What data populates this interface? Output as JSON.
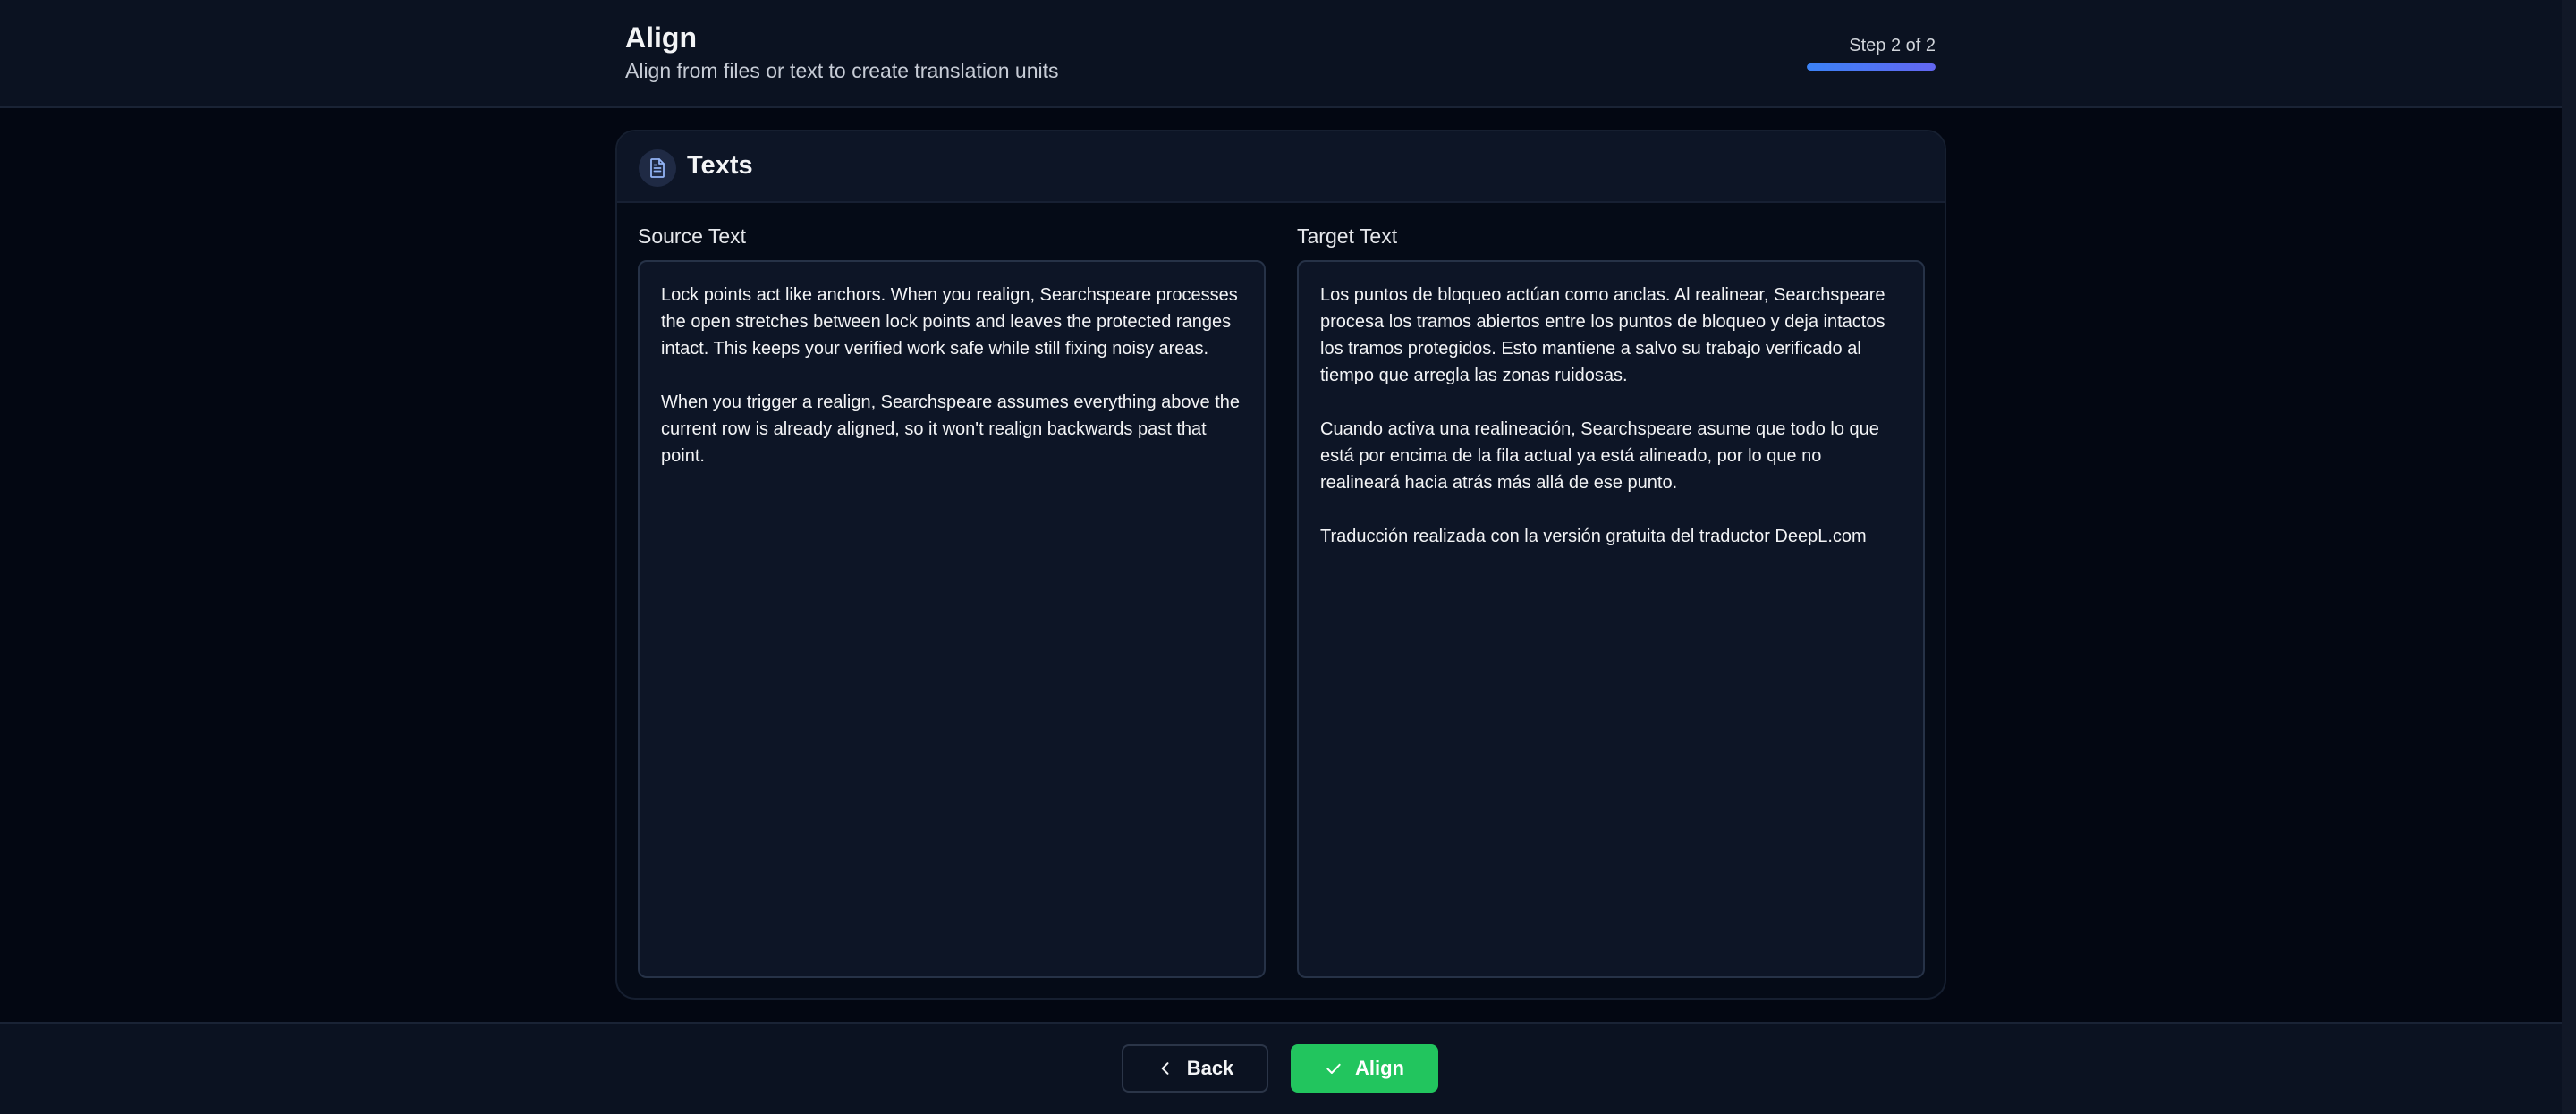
{
  "header": {
    "title": "Align",
    "subtitle": "Align from files or text to create translation units",
    "step_label": "Step 2 of 2",
    "progress": 1.0
  },
  "card": {
    "title": "Texts",
    "icon": "document-icon",
    "source": {
      "label": "Source Text",
      "value": "Lock points act like anchors. When you realign, Searchspeare processes the open stretches between lock points and leaves the protected ranges intact. This keeps your verified work safe while still fixing noisy areas.\n\nWhen you trigger a realign, Searchspeare assumes everything above the current row is already aligned, so it won't realign backwards past that point."
    },
    "target": {
      "label": "Target Text",
      "value": "Los puntos de bloqueo actúan como anclas. Al realinear, Searchspeare procesa los tramos abiertos entre los puntos de bloqueo y deja intactos los tramos protegidos. Esto mantiene a salvo su trabajo verificado al tiempo que arregla las zonas ruidosas.\n\nCuando activa una realineación, Searchspeare asume que todo lo que está por encima de la fila actual ya está alineado, por lo que no realineará hacia atrás más allá de ese punto.\n\nTraducción realizada con la versión gratuita del traductor DeepL.com"
    }
  },
  "footer": {
    "back_label": "Back",
    "align_label": "Align"
  },
  "colors": {
    "accent": "#3b82f6",
    "success": "#22c55e",
    "background": "#030712"
  }
}
